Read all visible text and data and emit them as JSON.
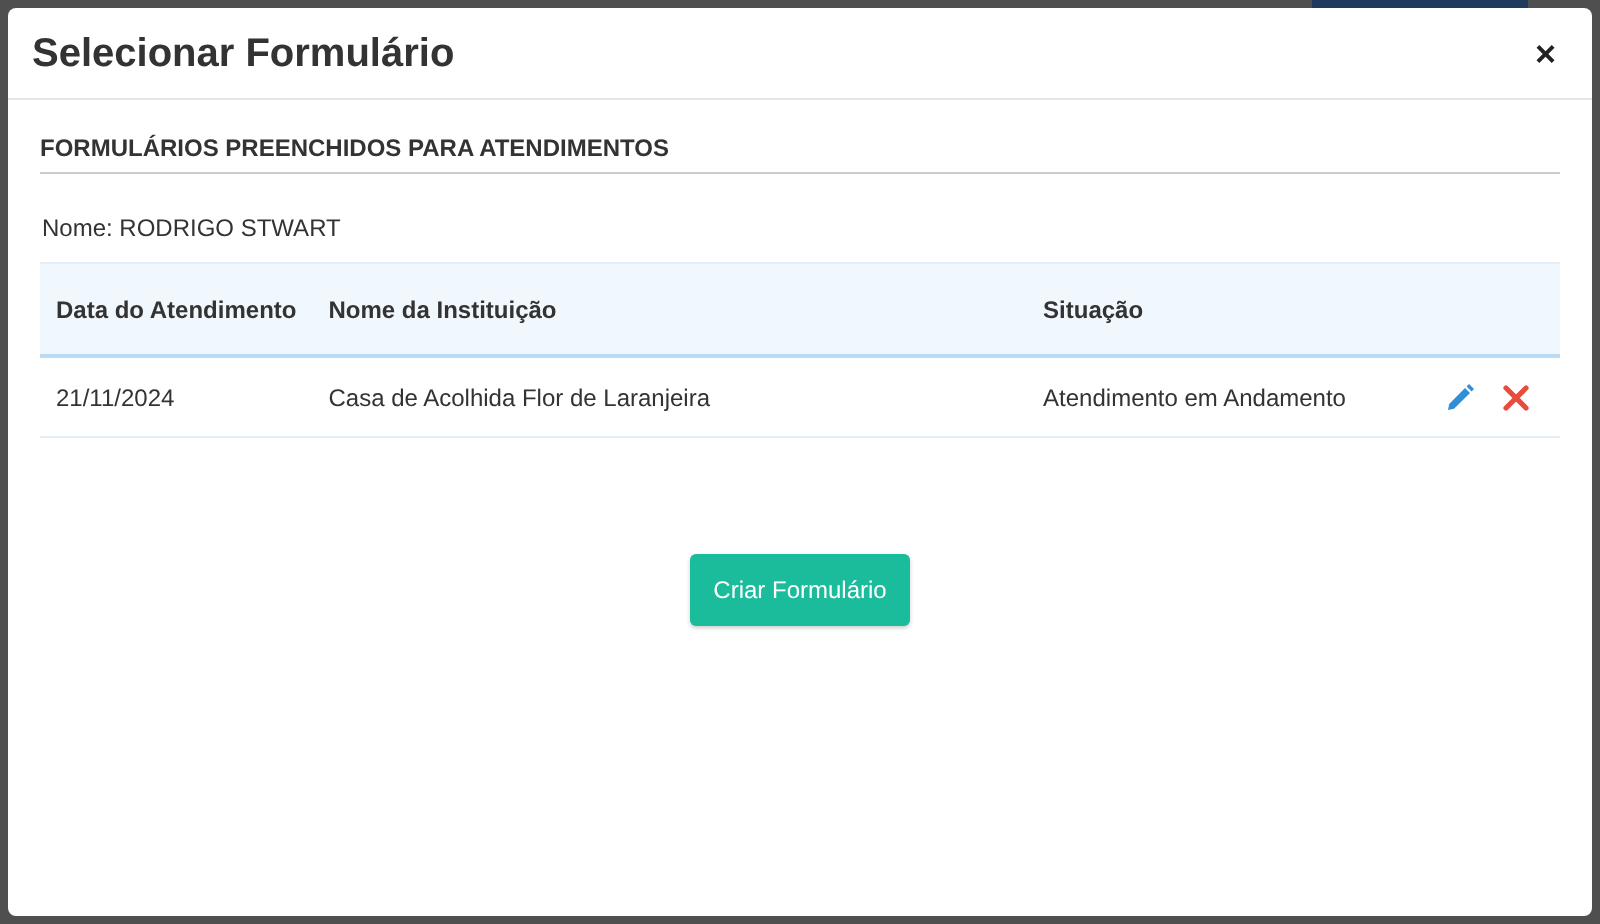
{
  "modal": {
    "title": "Selecionar Formulário",
    "close": "×"
  },
  "section": {
    "heading": "FORMULÁRIOS PREENCHIDOS PARA ATENDIMENTOS",
    "name_line": "Nome: RODRIGO STWART"
  },
  "table": {
    "columns": [
      "Data do Atendimento",
      "Nome da Instituição",
      "Situação"
    ],
    "rows": [
      {
        "cells": [
          "21/11/2024",
          "Casa de Acolhida Flor de Laranjeira",
          "Atendimento em Andamento"
        ],
        "actions": [
          {
            "kind": "edit"
          },
          {
            "kind": "delete"
          }
        ]
      }
    ]
  },
  "primary_button": "Criar Formulário"
}
